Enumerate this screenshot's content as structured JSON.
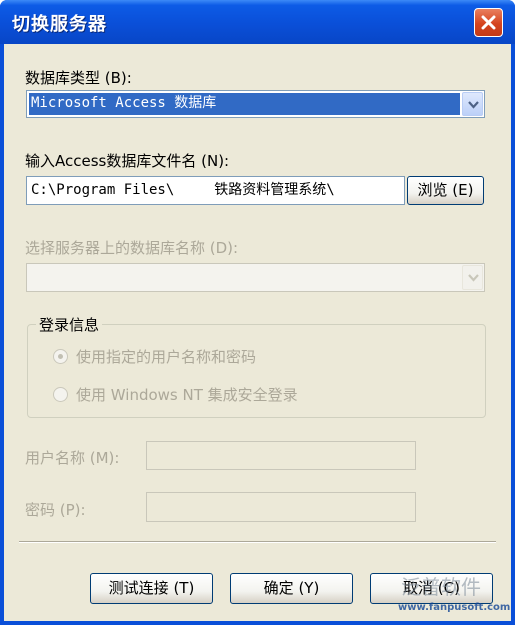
{
  "window": {
    "title": "切换服务器"
  },
  "db_type": {
    "label": "数据库类型 (B):",
    "selected": "Microsoft Access 数据库"
  },
  "db_file": {
    "label": "输入Access数据库文件名 (N):",
    "value_prefix": "C:\\Program Files\\",
    "value_suffix": "铁路资料管理系统\\",
    "browse_label": "浏览 (E)"
  },
  "server_db": {
    "label": "选择服务器上的数据库名称 (D):",
    "selected": ""
  },
  "login": {
    "group_title": "登录信息",
    "option_specified": "使用指定的用户名称和密码",
    "option_windows": "使用 Windows NT 集成安全登录"
  },
  "username": {
    "label": "用户名称 (M):",
    "value": ""
  },
  "password": {
    "label": "密码 (P):",
    "value": ""
  },
  "buttons": {
    "test": "测试连接 (T)",
    "ok": "确定 (Y)",
    "cancel": "取消 (C)"
  },
  "watermark": {
    "brand": "泛普软件",
    "url": "www.fanpusoft.com"
  },
  "colors": {
    "titlebar": "#0a4fd8",
    "dialog_bg": "#ece9d8",
    "selection": "#316ac5",
    "close_button": "#d5441f"
  }
}
